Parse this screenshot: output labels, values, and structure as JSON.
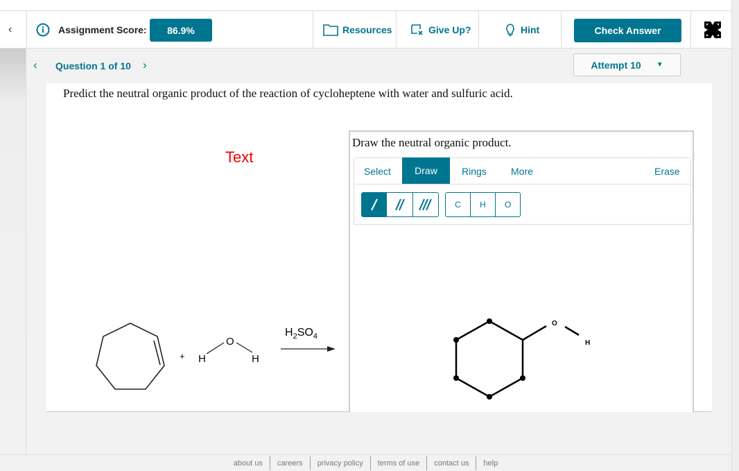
{
  "header": {
    "back_icon": "chevron-left",
    "info_icon": "info-circle",
    "score_label": "Assignment Score:",
    "score_value": "86.9%",
    "resources": "Resources",
    "give_up": "Give Up?",
    "hint": "Hint",
    "check_answer": "Check Answer",
    "fullscreen_icon": "expand-arrows"
  },
  "nav": {
    "question": "Question 1 of 10",
    "attempt": "Attempt 10"
  },
  "question": {
    "text": "Predict the neutral organic product of the reaction of cycloheptene with water and sulfuric acid.",
    "label": "Text"
  },
  "reaction": {
    "plus": "+",
    "h1": "H",
    "o": "O",
    "h2": "H",
    "reagent_main": "H",
    "reagent_sub2": "2",
    "reagent_so": "SO",
    "reagent_sub4": "4"
  },
  "drawing": {
    "title": "Draw the neutral organic product.",
    "tabs": [
      "Select",
      "Draw",
      "Rings",
      "More"
    ],
    "active_tab": "Draw",
    "erase": "Erase",
    "bond_tools": [
      "single-bond",
      "double-bond",
      "triple-bond"
    ],
    "atoms": [
      "C",
      "H",
      "O"
    ],
    "product_o": "O",
    "product_h": "H"
  },
  "footer": [
    "about us",
    "careers",
    "privacy policy",
    "terms of use",
    "contact us",
    "help"
  ],
  "colors": {
    "accent": "#007590",
    "text_label": "#e00000"
  }
}
